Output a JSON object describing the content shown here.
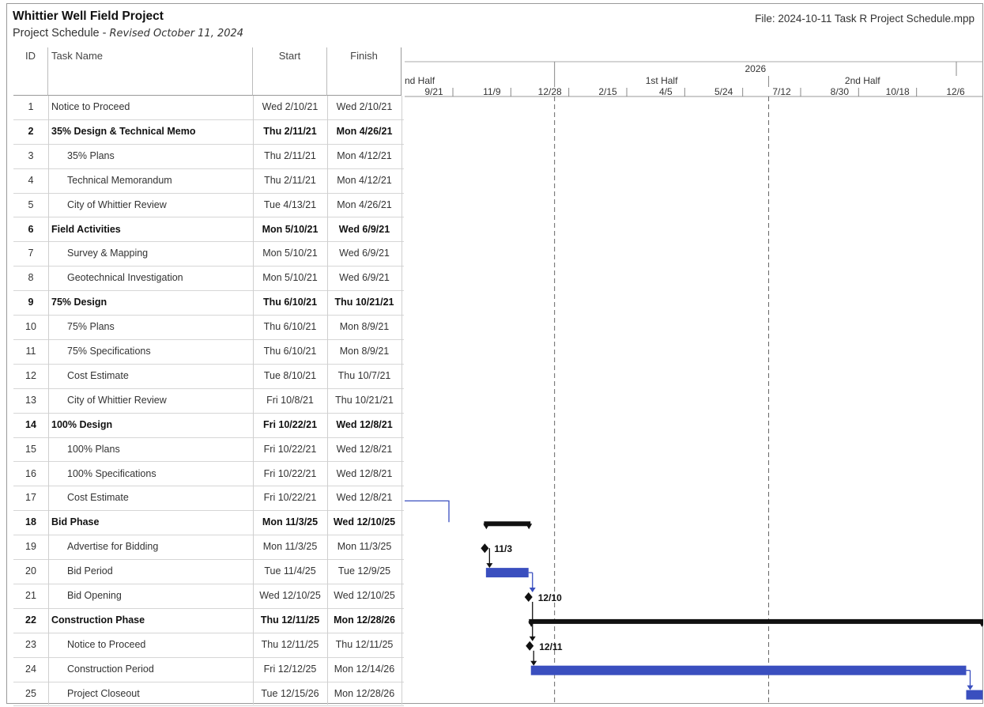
{
  "header": {
    "title": "Whittier Well Field Project",
    "subtitle_prefix": "Project Schedule - ",
    "subtitle_revised": "Revised October 11, 2024",
    "file": "File: 2024-10-11 Task R Project Schedule.mpp"
  },
  "columns": {
    "id": "ID",
    "name": "Task Name",
    "start": "Start",
    "finish": "Finish"
  },
  "timescale": {
    "year": "2026",
    "halves": [
      "nd Half",
      "1st Half",
      "2nd Half"
    ],
    "ticks": [
      "9/21",
      "11/9",
      "12/28",
      "2/15",
      "4/5",
      "5/24",
      "7/12",
      "8/30",
      "10/18",
      "12/6"
    ]
  },
  "tasks": [
    {
      "id": "1",
      "name": "Notice to Proceed",
      "start": "Wed 2/10/21",
      "finish": "Wed 2/10/21",
      "summary": false
    },
    {
      "id": "2",
      "name": "35% Design & Technical Memo",
      "start": "Thu 2/11/21",
      "finish": "Mon 4/26/21",
      "summary": true
    },
    {
      "id": "3",
      "name": "35% Plans",
      "start": "Thu 2/11/21",
      "finish": "Mon 4/12/21",
      "summary": false
    },
    {
      "id": "4",
      "name": "Technical Memorandum",
      "start": "Thu 2/11/21",
      "finish": "Mon 4/12/21",
      "summary": false
    },
    {
      "id": "5",
      "name": "City of Whittier Review",
      "start": "Tue 4/13/21",
      "finish": "Mon 4/26/21",
      "summary": false
    },
    {
      "id": "6",
      "name": "Field Activities",
      "start": "Mon 5/10/21",
      "finish": "Wed 6/9/21",
      "summary": true
    },
    {
      "id": "7",
      "name": "Survey & Mapping",
      "start": "Mon 5/10/21",
      "finish": "Wed 6/9/21",
      "summary": false
    },
    {
      "id": "8",
      "name": "Geotechnical Investigation",
      "start": "Mon 5/10/21",
      "finish": "Wed 6/9/21",
      "summary": false
    },
    {
      "id": "9",
      "name": "75% Design",
      "start": "Thu 6/10/21",
      "finish": "Thu 10/21/21",
      "summary": true
    },
    {
      "id": "10",
      "name": "75% Plans",
      "start": "Thu 6/10/21",
      "finish": "Mon 8/9/21",
      "summary": false
    },
    {
      "id": "11",
      "name": "75% Specifications",
      "start": "Thu 6/10/21",
      "finish": "Mon 8/9/21",
      "summary": false
    },
    {
      "id": "12",
      "name": "Cost Estimate",
      "start": "Tue 8/10/21",
      "finish": "Thu 10/7/21",
      "summary": false
    },
    {
      "id": "13",
      "name": "City of Whittier Review",
      "start": "Fri 10/8/21",
      "finish": "Thu 10/21/21",
      "summary": false
    },
    {
      "id": "14",
      "name": "100% Design",
      "start": "Fri 10/22/21",
      "finish": "Wed 12/8/21",
      "summary": true
    },
    {
      "id": "15",
      "name": "100% Plans",
      "start": "Fri 10/22/21",
      "finish": "Wed 12/8/21",
      "summary": false
    },
    {
      "id": "16",
      "name": "100% Specifications",
      "start": "Fri 10/22/21",
      "finish": "Wed 12/8/21",
      "summary": false
    },
    {
      "id": "17",
      "name": "Cost Estimate",
      "start": "Fri 10/22/21",
      "finish": "Wed 12/8/21",
      "summary": false
    },
    {
      "id": "18",
      "name": "Bid Phase",
      "start": "Mon 11/3/25",
      "finish": "Wed 12/10/25",
      "summary": true
    },
    {
      "id": "19",
      "name": "Advertise for Bidding",
      "start": "Mon 11/3/25",
      "finish": "Mon 11/3/25",
      "summary": false
    },
    {
      "id": "20",
      "name": "Bid Period",
      "start": "Tue 11/4/25",
      "finish": "Tue 12/9/25",
      "summary": false
    },
    {
      "id": "21",
      "name": "Bid Opening",
      "start": "Wed 12/10/25",
      "finish": "Wed 12/10/25",
      "summary": false
    },
    {
      "id": "22",
      "name": "Construction Phase",
      "start": "Thu 12/11/25",
      "finish": "Mon 12/28/26",
      "summary": true
    },
    {
      "id": "23",
      "name": "Notice to Proceed",
      "start": "Thu 12/11/25",
      "finish": "Thu 12/11/25",
      "summary": false
    },
    {
      "id": "24",
      "name": "Construction Period",
      "start": "Fri 12/12/25",
      "finish": "Mon 12/14/26",
      "summary": false
    },
    {
      "id": "25",
      "name": "Project Closeout",
      "start": "Tue 12/15/26",
      "finish": "Mon 12/28/26",
      "summary": false
    }
  ],
  "milestone_labels": {
    "19": "11/3",
    "21": "12/10",
    "23": "12/11"
  },
  "colors": {
    "task_bar": "#3a4fbf",
    "summary_bar": "#111111",
    "link": "#3a4fbf"
  }
}
